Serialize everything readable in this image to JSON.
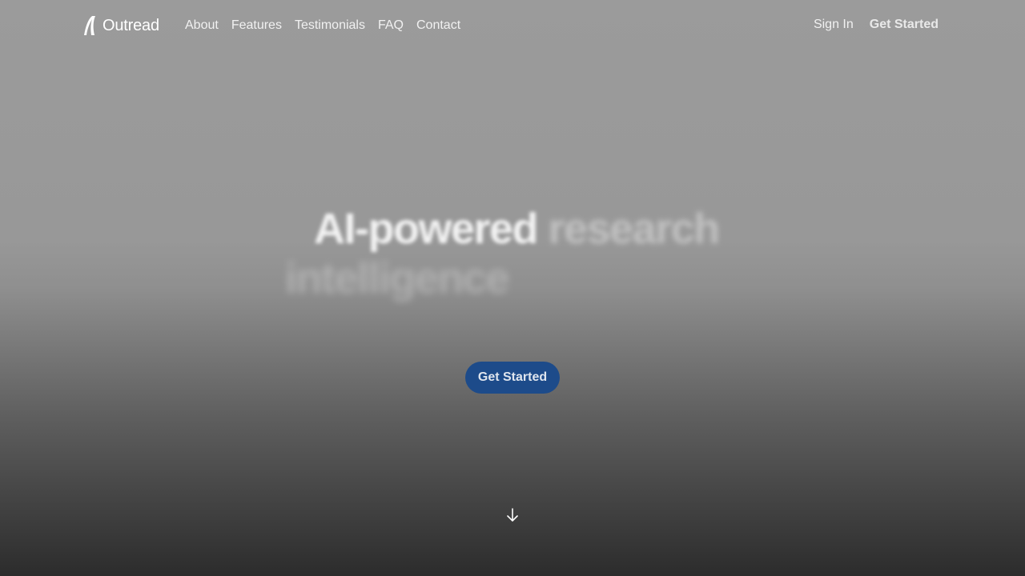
{
  "brand": {
    "name": "Outread"
  },
  "nav": {
    "links": [
      "About",
      "Features",
      "Testimonials",
      "FAQ",
      "Contact"
    ],
    "sign_in": "Sign In",
    "get_started": "Get Started"
  },
  "hero": {
    "headline_words": [
      "AI-powered",
      "research",
      "intelligence"
    ],
    "cta": "Get Started"
  },
  "icons": {
    "logo": "outread-logo-icon",
    "scroll": "arrow-down-icon"
  },
  "colors": {
    "cta_background": "#1d4b8a",
    "text": "#ffffff"
  }
}
